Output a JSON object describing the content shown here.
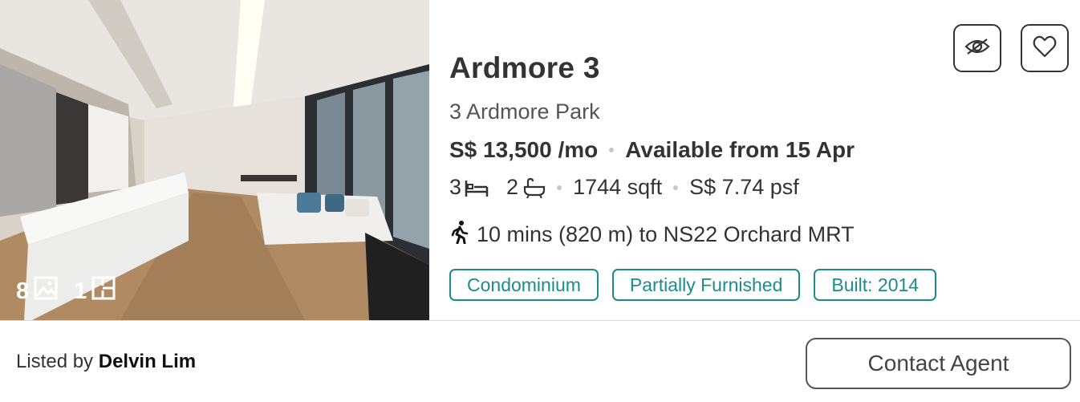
{
  "listing": {
    "title": "Ardmore 3",
    "address": "3 Ardmore Park",
    "price": "S$ 13,500 /mo",
    "availability": "Available from 15 Apr",
    "bedrooms": "3",
    "bathrooms": "2",
    "area": "1744 sqft",
    "psf": "S$ 7.74 psf",
    "mrt": "10 mins (820 m) to NS22 Orchard MRT",
    "tags": [
      "Condominium",
      "Partially Furnished",
      "Built: 2014"
    ]
  },
  "media": {
    "photo_count": "8",
    "floorplan_count": "1"
  },
  "footer": {
    "listed_by_prefix": "Listed by",
    "agent_name": "Delvin Lim",
    "contact_label": "Contact Agent"
  },
  "icons": {
    "hide": "eye-off-icon",
    "favourite": "heart-icon",
    "bed": "bed-icon",
    "bath": "bath-icon",
    "walk": "walk-icon",
    "photo": "image-icon",
    "floorplan": "floorplan-icon"
  },
  "colors": {
    "tag_accent": "#1a8c8c"
  }
}
